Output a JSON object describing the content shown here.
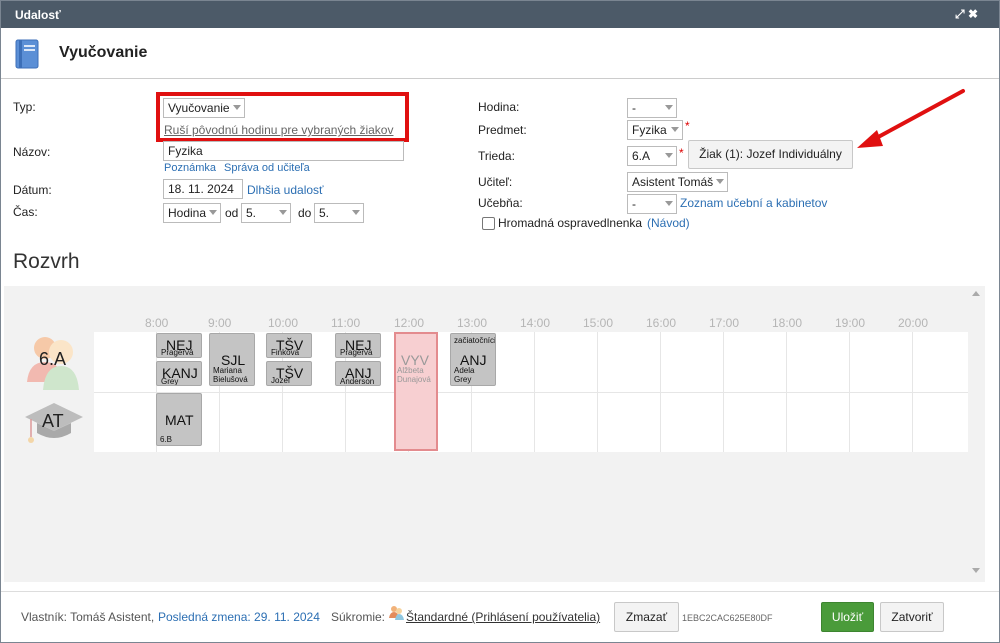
{
  "window": {
    "title": "Udalosť"
  },
  "header": {
    "title": "Vyučovanie"
  },
  "form": {
    "typ_label": "Typ:",
    "typ_value": "Vyučovanie",
    "typ_note": "Ruší pôvodnú hodinu pre vybraných žiakov",
    "nazov_label": "Názov:",
    "nazov_value": "Fyzika",
    "poznamka_link": "Poznámka",
    "sprava_link": "Správa od učiteľa",
    "datum_label": "Dátum:",
    "datum_value": "18. 11. 2024",
    "dlhsia_link": "Dlhšia udalosť",
    "cas_label": "Čas:",
    "cas_unit": "Hodina",
    "od_label": "od",
    "od_value": "5.",
    "do_label": "do",
    "do_value": "5.",
    "hodina_label": "Hodina:",
    "hodina_value": "-",
    "predmet_label": "Predmet:",
    "predmet_value": "Fyzika",
    "trieda_label": "Trieda:",
    "trieda_value": "6.A",
    "ziak_button": "Žiak (1): Jozef Individuálny",
    "ucitel_label": "Učiteľ:",
    "ucitel_value": "Asistent Tomáš",
    "ucebna_label": "Učebňa:",
    "ucebna_value": "-",
    "zoznam_link": "Zoznam učební a kabinetov",
    "hromadna_label": "Hromadná ospravedlnenka",
    "navod_link": "(Návod)",
    "required_mark": "*"
  },
  "schedule": {
    "title": "Rozvrh",
    "hours": [
      "8:00",
      "9:00",
      "10:00",
      "11:00",
      "12:00",
      "13:00",
      "14:00",
      "15:00",
      "16:00",
      "17:00",
      "18:00",
      "19:00",
      "20:00"
    ],
    "rows": [
      {
        "label": "6.A"
      },
      {
        "label": "AT"
      }
    ],
    "lessons": {
      "nej1": {
        "code": "NEJ",
        "sub": "Pragervá"
      },
      "kanj1": {
        "code": "KANJ",
        "sub": "Grey"
      },
      "sjl": {
        "code": "SJL",
        "sub1": "Mariana",
        "sub2": "Bielušová"
      },
      "tsv1": {
        "code": "TŠV",
        "sub": "Finková"
      },
      "tsv2": {
        "code": "TŠV",
        "sub": "Jozef"
      },
      "nej2": {
        "code": "NEJ",
        "sub": "Pragervá"
      },
      "anj1": {
        "code": "ANJ",
        "sub": "Anderson"
      },
      "vyv": {
        "code": "VYV",
        "sub1": "Alžbeta",
        "sub2": "Dunajová"
      },
      "anj2": {
        "top": "začiatočníci",
        "code": "ANJ",
        "sub1": "Adela",
        "sub2": "Grey"
      },
      "mat": {
        "code": "MAT",
        "sub": "6.B"
      }
    }
  },
  "footer": {
    "owner": "Vlastník: Tomáš Asistent,",
    "last_change": "Posledná zmena: 29. 11. 2024",
    "privacy_label": "Súkromie:",
    "privacy_value": "Štandardné (Prihlásení používatelia)",
    "delete_button": "Zmazať",
    "code": "1EBC2CAC625E80DF",
    "save_button": "Uložiť",
    "close_button": "Zatvoriť"
  },
  "colors": {
    "titlebar": "#4c5a68",
    "link": "#2c6fb3",
    "save": "#4a9b3a",
    "highlight": "#f7cfd1",
    "annotation": "#e01010"
  }
}
